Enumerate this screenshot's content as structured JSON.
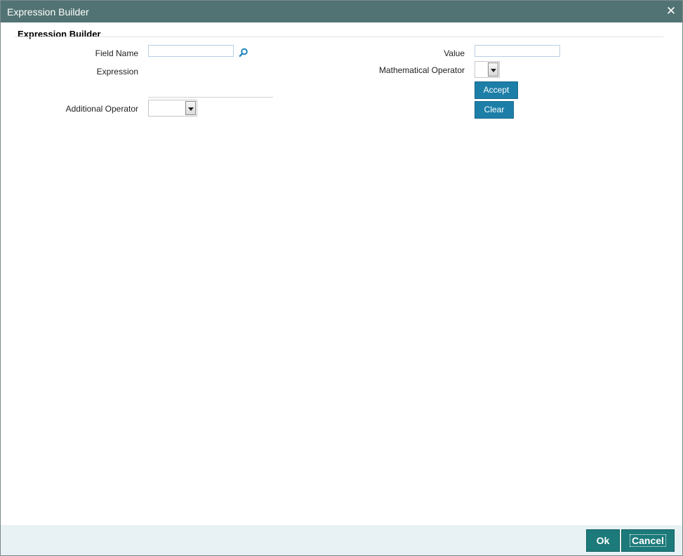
{
  "window": {
    "title": "Expression Builder",
    "close_glyph": "✕"
  },
  "section": {
    "header": "Expression Builder"
  },
  "form": {
    "field_name_label": "Field Name",
    "field_name_value": "",
    "expression_label": "Expression",
    "expression_value": "",
    "additional_operator_label": "Additional Operator",
    "additional_operator_value": "",
    "value_label": "Value",
    "value_value": "",
    "mathematical_operator_label": "Mathematical Operator",
    "mathematical_operator_value": ""
  },
  "actions": {
    "accept_label": "Accept",
    "clear_label": "Clear"
  },
  "footer": {
    "ok_label": "Ok",
    "cancel_label": "Cancel"
  },
  "icons": {
    "lookup": "search-icon",
    "close": "close-icon",
    "dropdown": "chevron-down-icon"
  },
  "colors": {
    "titlebar": "#527373",
    "accent_button": "#1d7fa8",
    "footer_button": "#1d7a7a",
    "footer_bg": "#e8f1f4"
  }
}
